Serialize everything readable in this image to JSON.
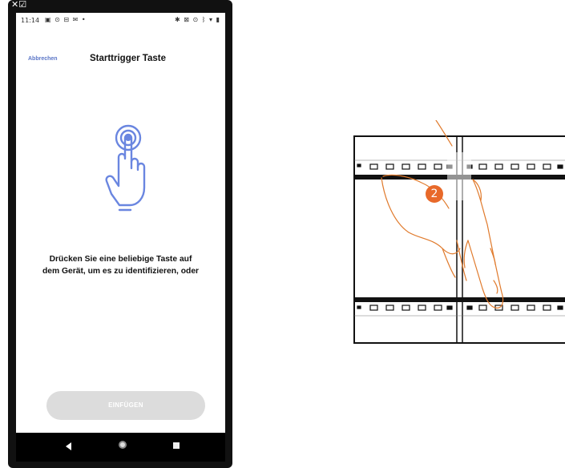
{
  "phone": {
    "corner_icon": "✕☑",
    "status_time": "11:14",
    "status_left_icons": "▣ ⊙ ⊟ ✉ •",
    "status_right_icons": "✱ ⊠ ⊙ ᛒ ▾ ▮"
  },
  "header": {
    "cancel_label": "Abbrechen",
    "title": "Starttrigger Taste"
  },
  "main": {
    "icon": "touch-hand-icon",
    "instruction_line1": "Drücken Sie eine beliebige Taste auf",
    "instruction_line2": "dem Gerät, um es zu identifizieren, oder"
  },
  "actions": {
    "insert_label": "EINFÜGEN"
  },
  "navbar": {
    "back_icon": "back-icon",
    "home_icon": "home-icon",
    "recents_icon": "recents-icon"
  },
  "illustration": {
    "step_number": "2"
  },
  "colors": {
    "accent_blue": "#5b76c7",
    "icon_blue": "#6a86e0",
    "step_orange": "#e8692a",
    "button_disabled": "#dcdcdc",
    "finger_outline": "#e07a2c"
  }
}
